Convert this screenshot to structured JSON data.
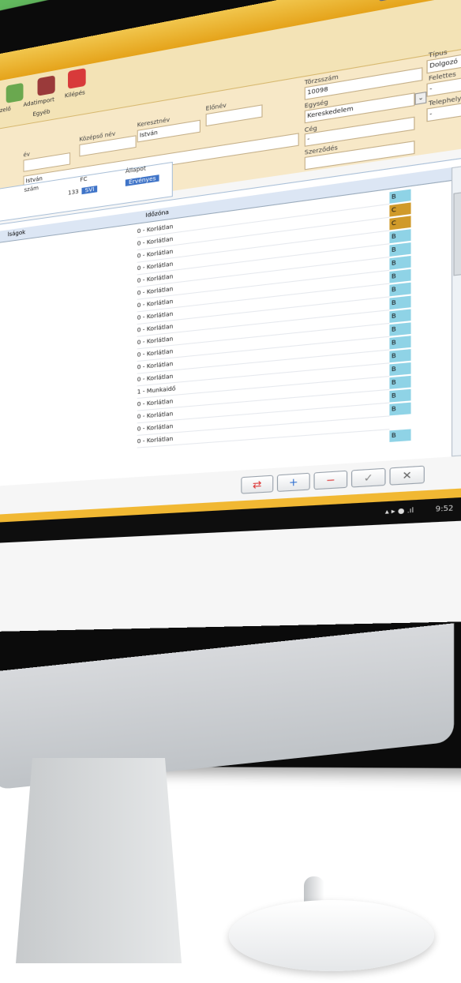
{
  "toolbar": {
    "buttons": [
      {
        "label": "zelő",
        "icon": "person-icon"
      },
      {
        "label": "Adatimport",
        "icon": "database-icon"
      },
      {
        "label": "Kilépés",
        "icon": "power-icon"
      }
    ],
    "group_label": "Egyéb"
  },
  "form": {
    "torzsszam_label": "Törzsszám",
    "torzsszam_value": "10098",
    "tipus_label": "Típus",
    "tipus_value": "Dolgozó",
    "egyseg_label": "Egység",
    "egyseg_value": "Kereskedelem",
    "felettes_label": "Felettes",
    "felettes_value": "-",
    "ceg_label": "Cég",
    "ceg_value": "-",
    "telephely_label": "Telephely",
    "telephely_value": "-",
    "szerzodes_label": "Szerződés",
    "keresztnev_label": "Keresztnév",
    "keresztnev_value": "István",
    "kozepso_label": "Középső név",
    "elonev_label": "Előnév",
    "nev_label": "év",
    "nev_value": "István"
  },
  "subgrid": {
    "columns": [
      "szám",
      "FC",
      "Állapot"
    ],
    "row": {
      "num": "133",
      "fc": "SVI",
      "allapot": "Érvényes"
    }
  },
  "grid": {
    "headers": [
      "lságok",
      "Időzóna"
    ],
    "rows": [
      {
        "zone": "0 - Korlátlan",
        "flag": "B"
      },
      {
        "zone": "0 - Korlátlan",
        "flag": "C"
      },
      {
        "zone": "0 - Korlátlan",
        "flag": "C"
      },
      {
        "zone": "0 - Korlátlan",
        "flag": "B"
      },
      {
        "zone": "0 - Korlátlan",
        "flag": "B"
      },
      {
        "zone": "0 - Korlátlan",
        "flag": "B"
      },
      {
        "zone": "0 - Korlátlan",
        "flag": "B"
      },
      {
        "zone": "0 - Korlátlan",
        "flag": "B"
      },
      {
        "zone": "0 - Korlátlan",
        "flag": "B"
      },
      {
        "zone": "0 - Korlátlan",
        "flag": "B"
      },
      {
        "zone": "0 - Korlátlan",
        "flag": "B"
      },
      {
        "zone": "0 - Korlátlan",
        "flag": "B"
      },
      {
        "zone": "0 - Korlátlan",
        "flag": "B"
      },
      {
        "zone": "1 - Munkaidő",
        "flag": "B"
      },
      {
        "zone": "0 - Korlátlan",
        "flag": "B"
      },
      {
        "zone": "0 - Korlátlan",
        "flag": "B"
      },
      {
        "zone": "0 - Korlátlan",
        "flag": "B"
      },
      {
        "zone": "0 - Korlátlan",
        "flag": ""
      }
    ],
    "extra_flag": "B"
  },
  "buttons": {
    "refresh": "⇄",
    "add": "+",
    "remove": "−",
    "ok": "✓",
    "cancel": "✕"
  },
  "taskbar": {
    "time": "9:52"
  }
}
